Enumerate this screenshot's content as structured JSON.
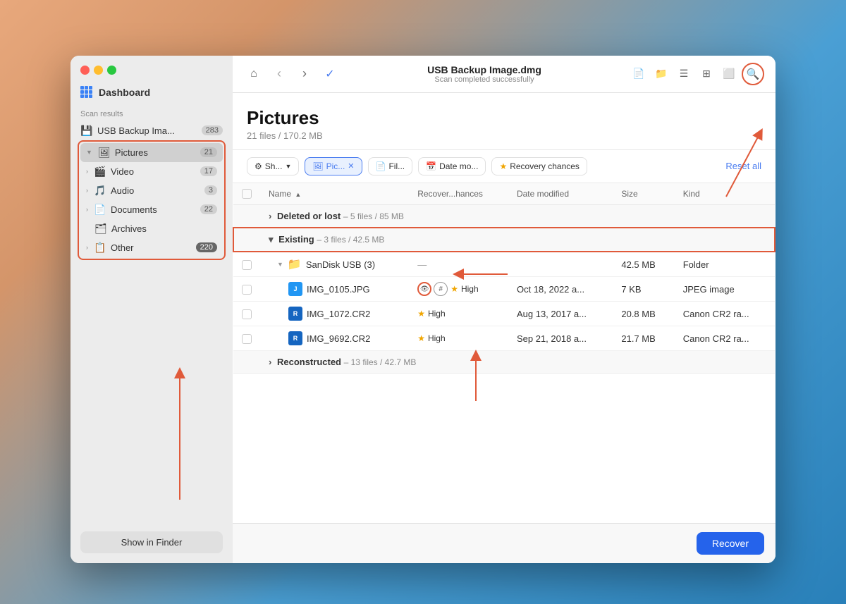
{
  "window": {
    "title": "USB Backup Image.dmg",
    "subtitle": "Scan completed successfully"
  },
  "sidebar": {
    "dashboard_label": "Dashboard",
    "scan_results_label": "Scan results",
    "items": [
      {
        "id": "usb",
        "label": "USB Backup Ima...",
        "count": "283",
        "icon": "💾",
        "has_chevron": false
      },
      {
        "id": "pictures",
        "label": "Pictures",
        "count": "21",
        "icon": "🖼",
        "has_chevron": true,
        "active": true
      },
      {
        "id": "video",
        "label": "Video",
        "count": "17",
        "icon": "🎬",
        "has_chevron": true
      },
      {
        "id": "audio",
        "label": "Audio",
        "count": "3",
        "icon": "🎵",
        "has_chevron": true
      },
      {
        "id": "documents",
        "label": "Documents",
        "count": "22",
        "icon": "📄",
        "has_chevron": true
      },
      {
        "id": "archives",
        "label": "Archives",
        "count": "",
        "icon": "🗂",
        "has_chevron": false
      },
      {
        "id": "other",
        "label": "Other",
        "count": "220",
        "icon": "📋",
        "has_chevron": true
      }
    ],
    "show_finder_btn": "Show in Finder"
  },
  "toolbar": {
    "home_icon": "⌂",
    "back_icon": "‹",
    "forward_icon": "›",
    "check_icon": "✓",
    "view_icons": [
      "📄",
      "📁",
      "≡",
      "⊞",
      "⬜"
    ],
    "search_icon": "🔍"
  },
  "page": {
    "title": "Pictures",
    "subtitle": "21 files / 170.2 MB"
  },
  "filters": {
    "show_btn": "Sh...",
    "pictures_filter": "Pic...",
    "files_filter": "Fil...",
    "date_filter": "Date mo...",
    "recovery_filter": "Recovery chances",
    "reset_all": "Reset all"
  },
  "table": {
    "columns": [
      "Name",
      "Recover...hances",
      "Date modified",
      "Size",
      "Kind"
    ],
    "groups": [
      {
        "id": "deleted",
        "label": "Deleted or lost",
        "info": "5 files / 85 MB",
        "collapsed": true,
        "rows": []
      },
      {
        "id": "existing",
        "label": "Existing",
        "info": "3 files / 42.5 MB",
        "collapsed": false,
        "rows": [
          {
            "id": "folder",
            "type": "folder",
            "name": "SanDisk USB (3)",
            "recovery": "—",
            "date": "",
            "size": "42.5 MB",
            "kind": "Folder"
          },
          {
            "id": "img0105",
            "type": "jpeg",
            "name": "IMG_0105.JPG",
            "recovery": "High",
            "date": "Oct 18, 2022 a...",
            "size": "7 KB",
            "kind": "JPEG image"
          },
          {
            "id": "img1072",
            "type": "cr2",
            "name": "IMG_1072.CR2",
            "recovery": "High",
            "date": "Aug 13, 2017 a...",
            "size": "20.8 MB",
            "kind": "Canon CR2 ra..."
          },
          {
            "id": "img9692",
            "type": "cr2",
            "name": "IMG_9692.CR2",
            "recovery": "High",
            "date": "Sep 21, 2018 a...",
            "size": "21.7 MB",
            "kind": "Canon CR2 ra..."
          }
        ]
      },
      {
        "id": "reconstructed",
        "label": "Reconstructed",
        "info": "13 files / 42.7 MB",
        "collapsed": true,
        "rows": []
      }
    ]
  },
  "bottom": {
    "recover_btn": "Recover"
  }
}
